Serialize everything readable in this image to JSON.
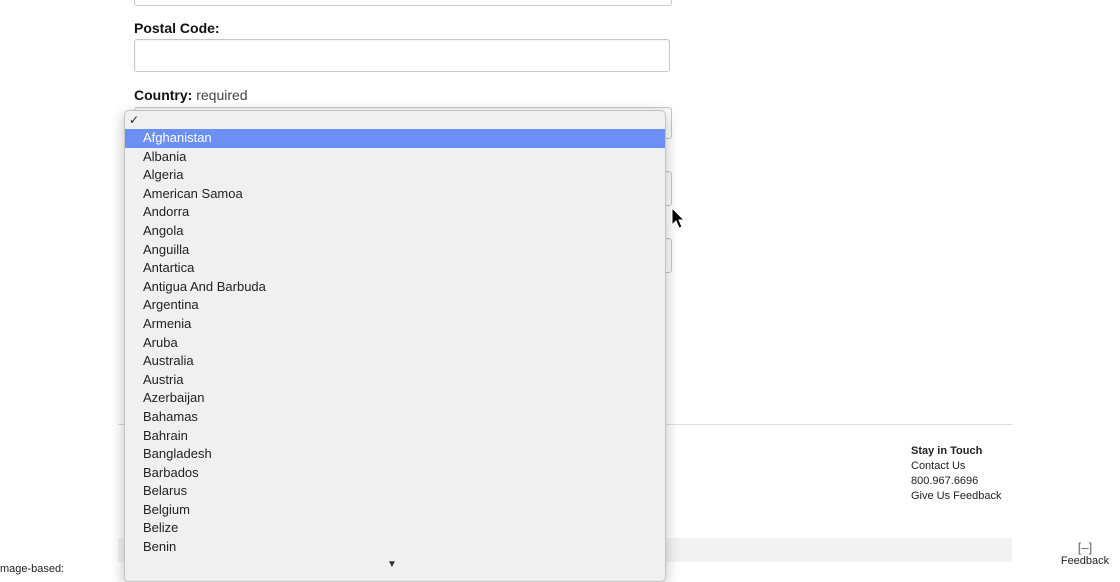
{
  "form": {
    "postal_code_label": "Postal Code:",
    "postal_code_value": "",
    "country_label": "Country:",
    "country_required": "required",
    "country_selected": "✓"
  },
  "dropdown": {
    "highlighted": "Afghanistan",
    "options": [
      "Afghanistan",
      "Albania",
      "Algeria",
      "American Samoa",
      "Andorra",
      "Angola",
      "Anguilla",
      "Antartica",
      "Antigua And Barbuda",
      "Argentina",
      "Armenia",
      "Aruba",
      "Australia",
      "Austria",
      "Azerbaijan",
      "Bahamas",
      "Bahrain",
      "Bangladesh",
      "Barbados",
      "Belarus",
      "Belgium",
      "Belize",
      "Benin"
    ],
    "scroll_arrow": "▼"
  },
  "footer": {
    "heading": "Stay in Touch",
    "links": [
      "Contact Us",
      "800.967.6696",
      "Give Us Feedback"
    ]
  },
  "feedback_widget": {
    "icon": "[–]",
    "label": "Feedback"
  },
  "bottom_left_text": "mage-based:",
  "colors": {
    "highlight": "#6b8ff5"
  }
}
